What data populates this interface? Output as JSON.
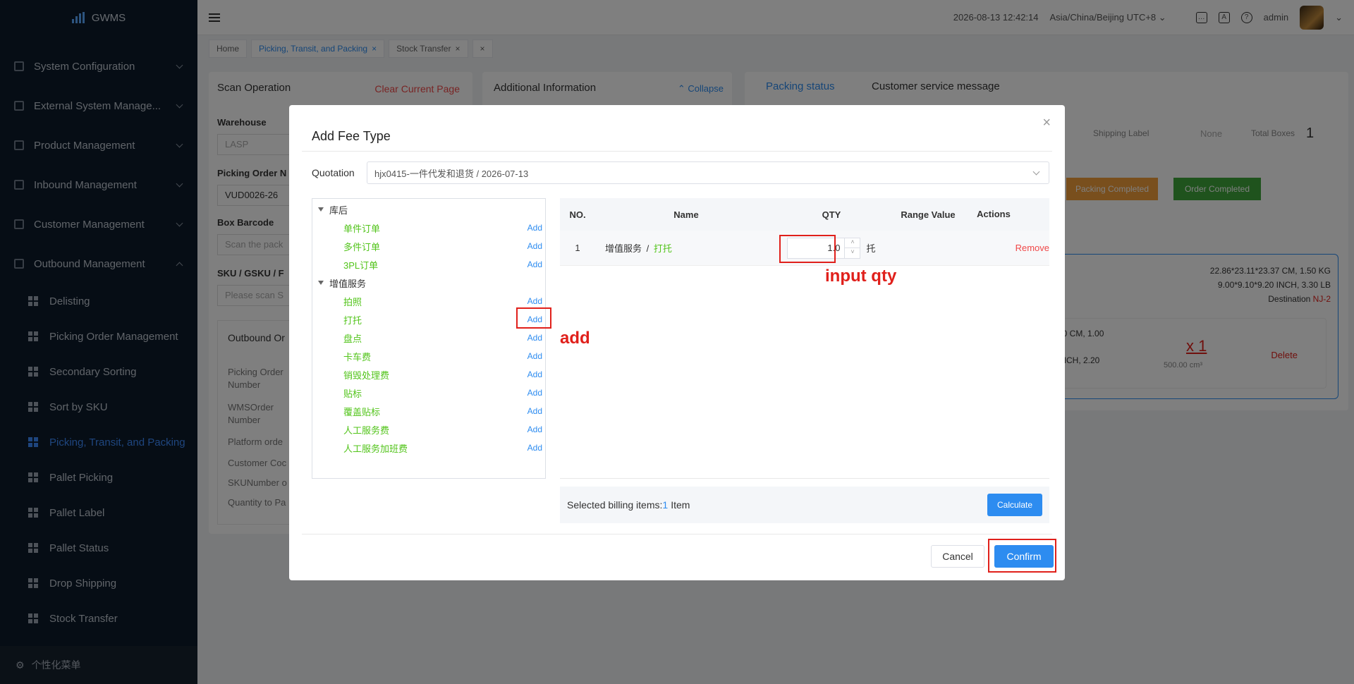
{
  "app": {
    "name": "GWMS"
  },
  "sidebar": {
    "items": [
      {
        "label": "System Configuration"
      },
      {
        "label": "External System Manage..."
      },
      {
        "label": "Product Management"
      },
      {
        "label": "Inbound Management"
      },
      {
        "label": "Customer Management"
      },
      {
        "label": "Outbound Management"
      }
    ],
    "sub_items": [
      {
        "label": "Delisting"
      },
      {
        "label": "Picking Order Management"
      },
      {
        "label": "Secondary Sorting"
      },
      {
        "label": "Sort by SKU"
      },
      {
        "label": "Picking, Transit, and Packing"
      },
      {
        "label": "Pallet Picking"
      },
      {
        "label": "Pallet Label"
      },
      {
        "label": "Pallet Status"
      },
      {
        "label": "Drop Shipping"
      },
      {
        "label": "Stock Transfer"
      }
    ],
    "footer": "个性化菜单"
  },
  "header": {
    "datetime": "2026-08-13 12:42:14",
    "timezone": "Asia/China/Beijing UTC+8",
    "user": "admin"
  },
  "tabs": [
    {
      "label": "Home"
    },
    {
      "label": "Picking, Transit, and Packing"
    },
    {
      "label": "Stock Transfer"
    }
  ],
  "background": {
    "scan_title": "Scan Operation",
    "clear_page": "Clear Current Page",
    "warehouse_label": "Warehouse",
    "warehouse_value": "LASP",
    "picking_order_label": "Picking Order N",
    "picking_order_value": "VUD0026-26",
    "box_barcode_label": "Box Barcode",
    "box_barcode_placeholder": "Scan the pack",
    "sku_label": "SKU / GSKU / F",
    "sku_placeholder": "Please scan S",
    "outbound_label": "Outbound Or",
    "fields": [
      "Picking Order Number",
      "WMSOrder Number",
      "Platform orde",
      "Customer Coc",
      "SKUNumber o",
      "Quantity to Pa"
    ],
    "additional_info": "Additional Information",
    "collapse": "Collapse",
    "packing_status": "Packing status",
    "customer_msg": "Customer service message",
    "shipping_label": "Shipping Label",
    "shipping_value": "None",
    "total_boxes_label": "Total Boxes",
    "total_boxes_value": "1",
    "packing_completed": "Packing Completed",
    "order_completed": "Order Completed",
    "dims_cm": "22.86*23.11*23.37 CM, 1.50 KG",
    "dims_inch": "9.00*9.10*9.20 INCH, 3.30 LB",
    "destination_label": "Destination",
    "destination_value": "NJ-2",
    "box_cm": "00 CM, 1.00",
    "box_inch": "INCH, 2.20",
    "box_qty": "x 1",
    "box_volume": "500.00 cm³",
    "delete": "Delete"
  },
  "dialog": {
    "title": "Add Fee Type",
    "quotation_label": "Quotation",
    "quotation_value": "hjx0415-一件代发和退货 / 2026-07-13",
    "tree": [
      {
        "label": "库后",
        "children": [
          "单件订单",
          "多件订单",
          "3PL订单"
        ]
      },
      {
        "label": "增值服务",
        "children": [
          "拍照",
          "打托",
          "盘点",
          "卡车费",
          "销毁处理费",
          "贴标",
          "覆盖贴标",
          "人工服务费",
          "人工服务加班费"
        ]
      }
    ],
    "add_label": "Add",
    "table": {
      "headers": [
        "NO.",
        "Name",
        "QTY",
        "Range Value",
        "Actions"
      ],
      "rows": [
        {
          "no": "1",
          "category": "增值服务",
          "sep": "/",
          "item": "打托",
          "qty": "1.0",
          "unit": "托",
          "range": "",
          "action": "Remove"
        }
      ]
    },
    "selected_text": "Selected billing items:",
    "selected_count": "1",
    "selected_unit": "Item",
    "calculate": "Calculate",
    "cancel": "Cancel",
    "confirm": "Confirm"
  },
  "annotations": {
    "add": "add",
    "input_qty": "input qty"
  }
}
